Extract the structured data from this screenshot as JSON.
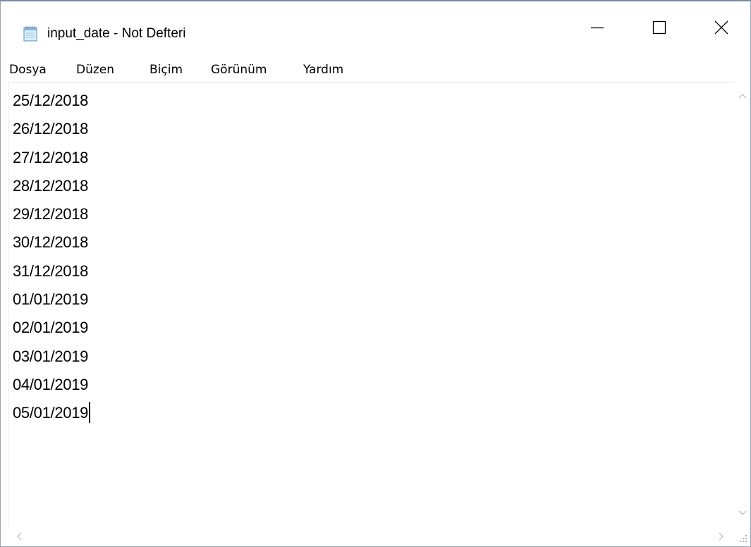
{
  "window": {
    "title": "input_date - Not Defteri"
  },
  "titlebar": {
    "icon": "notepad-icon",
    "minimize_icon": "minimize-icon",
    "maximize_icon": "maximize-icon",
    "close_icon": "close-icon"
  },
  "menu": {
    "items": [
      {
        "label": "Dosya"
      },
      {
        "label": "Düzen"
      },
      {
        "label": "Biçim"
      },
      {
        "label": "Görünüm"
      },
      {
        "label": "Yardım"
      }
    ]
  },
  "editor": {
    "lines": [
      "25/12/2018",
      "26/12/2018",
      "27/12/2018",
      "28/12/2018",
      "29/12/2018",
      "30/12/2018",
      "31/12/2018",
      "01/01/2019",
      "02/01/2019",
      "03/01/2019",
      "04/01/2019",
      "05/01/2019"
    ]
  },
  "scrollbars": {
    "up_icon": "chevron-up-icon",
    "down_icon": "chevron-down-icon",
    "left_icon": "chevron-left-icon",
    "right_icon": "chevron-right-icon",
    "grip_icon": "resize-grip-icon"
  },
  "colors": {
    "border": "#9ba3b0",
    "text": "#000000",
    "scroll_arrow": "#c0c0c0"
  }
}
